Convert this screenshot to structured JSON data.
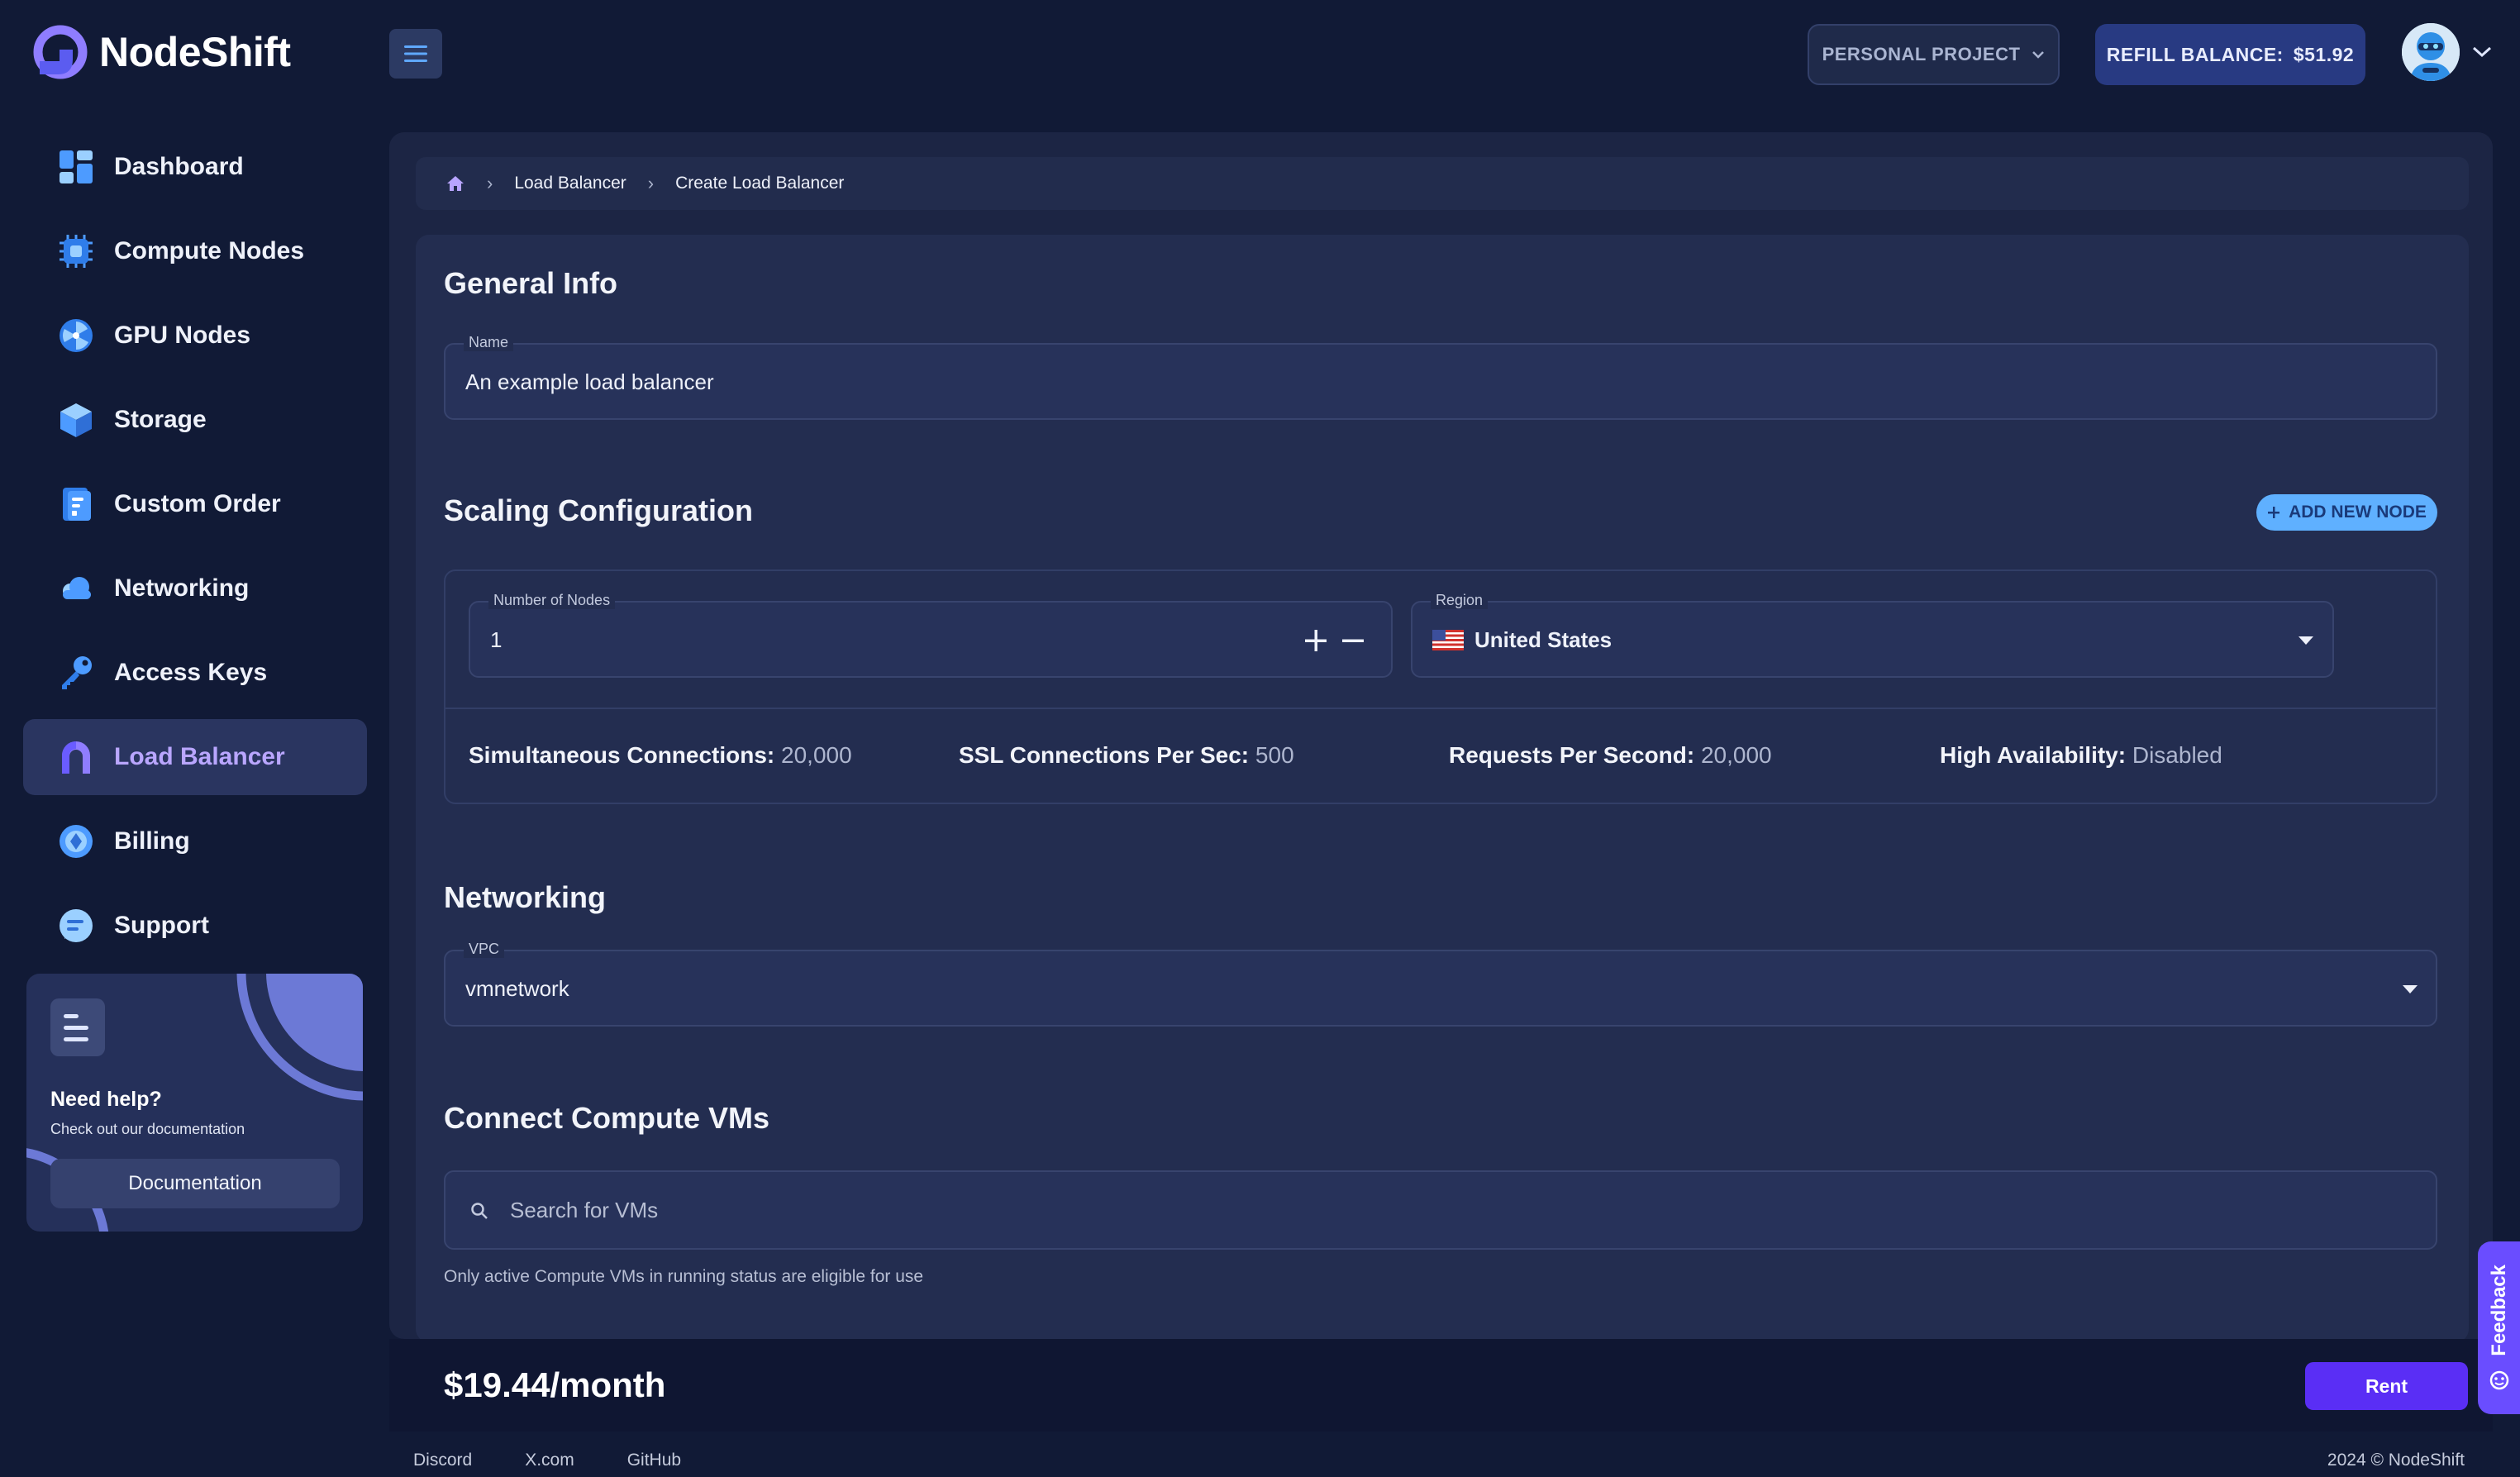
{
  "brand": {
    "name": "NodeShift"
  },
  "header": {
    "project_label": "PERSONAL PROJECT",
    "refill_label": "REFILL BALANCE:",
    "balance": "$51.92"
  },
  "sidebar": {
    "items": [
      {
        "label": "Dashboard",
        "icon": "dashboard-icon"
      },
      {
        "label": "Compute Nodes",
        "icon": "cpu-icon"
      },
      {
        "label": "GPU Nodes",
        "icon": "gpu-icon"
      },
      {
        "label": "Storage",
        "icon": "storage-cube-icon"
      },
      {
        "label": "Custom Order",
        "icon": "custom-order-icon"
      },
      {
        "label": "Networking",
        "icon": "cloud-icon"
      },
      {
        "label": "Access Keys",
        "icon": "key-icon"
      },
      {
        "label": "Load Balancer",
        "icon": "load-balancer-icon",
        "active": true
      },
      {
        "label": "Billing",
        "icon": "billing-icon"
      },
      {
        "label": "Support",
        "icon": "support-icon"
      }
    ],
    "help": {
      "title": "Need help?",
      "subtitle": "Check out our documentation",
      "button": "Documentation"
    }
  },
  "breadcrumb": {
    "items": [
      "Load Balancer",
      "Create Load Balancer"
    ]
  },
  "general": {
    "title": "General Info",
    "name_label": "Name",
    "name_value": "An example load balancer"
  },
  "scaling": {
    "title": "Scaling Configuration",
    "add_node": "ADD NEW NODE",
    "nodes_label": "Number of Nodes",
    "nodes_value": "1",
    "region_label": "Region",
    "region_value": "United States",
    "metrics": [
      {
        "label": "Simultaneous Connections:",
        "value": "20,000"
      },
      {
        "label": "SSL Connections Per Sec:",
        "value": "500"
      },
      {
        "label": "Requests Per Second:",
        "value": "20,000"
      },
      {
        "label": "High Availability:",
        "value": "Disabled"
      }
    ]
  },
  "networking": {
    "title": "Networking",
    "vpc_label": "VPC",
    "vpc_value": "vmnetwork"
  },
  "connect": {
    "title": "Connect Compute VMs",
    "search_placeholder": "Search for VMs",
    "hint": "Only active Compute VMs in running status are eligible for use"
  },
  "footer": {
    "price": "$19.44/month",
    "rent": "Rent",
    "links": [
      "Discord",
      "X.com",
      "GitHub"
    ],
    "copyright": "2024 © NodeShift",
    "feedback": "Feedback"
  },
  "colors": {
    "background": "#111a36",
    "accent": "#5a2ef5",
    "active_nav_text": "#b9a6ff",
    "add_node_button": "#5fb0ff"
  }
}
